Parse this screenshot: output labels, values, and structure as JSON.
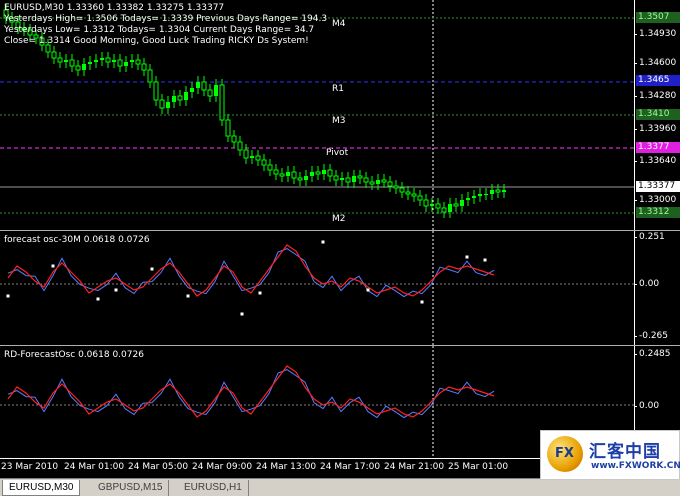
{
  "main": {
    "header_line": "EURUSD,M30  1.33360 1.33382 1.33275 1.33377",
    "yesterday_high": "Yesterdays High= 1.3506  Todays= 1.3339    Previous Days Range= 194.3",
    "yesterday_low": "Yesterdays Low= 1.3312  Todays= 1.3304    Current Days Range= 34.7",
    "close_line": "Close= 1.3314  Good Morning, Good Luck Trading RICKY Ds System!",
    "levels": [
      {
        "label": "M4",
        "price": "1.3507",
        "color": "#2e8b2e",
        "style": "dot"
      },
      {
        "label": "",
        "price": "1.3465",
        "color": "#3030ff",
        "style": "dash"
      },
      {
        "label": "R1",
        "price": "",
        "color": "#2e8b2e",
        "style": "none"
      },
      {
        "label": "",
        "price": "1.3410",
        "color": "#2e8b2e",
        "style": "dot"
      },
      {
        "label": "M3",
        "price": "",
        "color": "#2e8b2e",
        "style": "none"
      },
      {
        "label": "",
        "price": "1.3377",
        "color": "#ff33ff",
        "style": "dash"
      },
      {
        "label": "Pivot",
        "price": "",
        "color": "#2e8b2e",
        "style": "none"
      },
      {
        "label": "M2",
        "price": "1.3312",
        "color": "#2e8b2e",
        "style": "dot"
      }
    ],
    "price_scale": [
      "1.34930",
      "1.34600",
      "1.34280",
      "1.33960",
      "1.33640",
      "1.33000"
    ],
    "last_price": "1.33377"
  },
  "osc1": {
    "title": "forecast osc-30M 0.0618 0.0726",
    "scale": [
      "0.251",
      "0.00",
      "-0.265"
    ]
  },
  "osc2": {
    "title": "RD-ForecastOsc 0.0618 0.0726",
    "scale": [
      "0.2485",
      "0.00"
    ]
  },
  "time_labels": [
    "23 Mar 2010",
    "24 Mar 01:00",
    "24 Mar 05:00",
    "24 Mar 09:00",
    "24 Mar 13:00",
    "24 Mar 17:00",
    "24 Mar 21:00",
    "25 Mar 01:00"
  ],
  "tabs": [
    "EURUSD,M30",
    "GBPUSD,M15",
    "EURUSD,H1"
  ],
  "logo": {
    "emblem": "FX",
    "title": "汇客中国",
    "url": "www.FXWORK.CN"
  },
  "colors": {
    "candle": "#00ff00",
    "osc_red": "#ff2020",
    "osc_blue": "#5a7cff",
    "grid": "#808080",
    "marker": "#ffffff"
  }
}
